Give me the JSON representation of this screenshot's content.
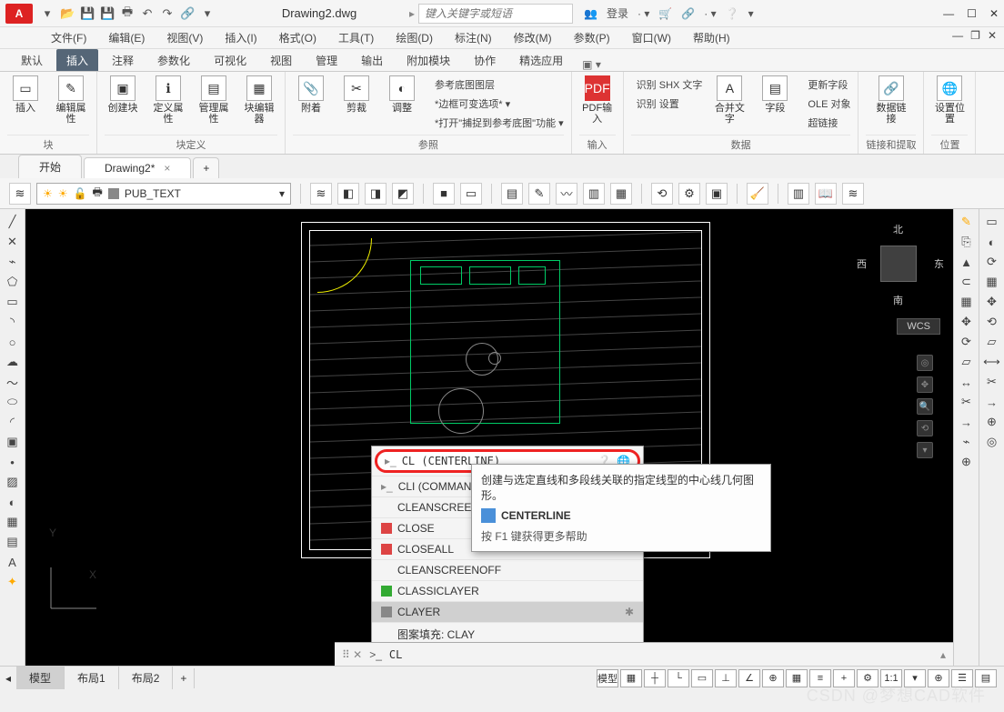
{
  "title": "Drawing2.dwg",
  "search_placeholder": "键入关键字或短语",
  "login": "登录",
  "menus": [
    "文件(F)",
    "编辑(E)",
    "视图(V)",
    "插入(I)",
    "格式(O)",
    "工具(T)",
    "绘图(D)",
    "标注(N)",
    "修改(M)",
    "参数(P)",
    "窗口(W)",
    "帮助(H)"
  ],
  "ribbon_tabs": [
    "默认",
    "插入",
    "注释",
    "参数化",
    "可视化",
    "视图",
    "管理",
    "输出",
    "附加模块",
    "协作",
    "精选应用"
  ],
  "active_ribbon_tab": "插入",
  "panels": {
    "block": {
      "title": "块",
      "items": [
        "插入",
        "编辑属性"
      ]
    },
    "blockdef": {
      "title": "块定义",
      "items": [
        "创建块",
        "定义属性",
        "管理属性",
        "块编辑器"
      ]
    },
    "ref": {
      "title": "参照",
      "items": [
        "附着",
        "剪裁",
        "调整"
      ],
      "lines": [
        "参考底图图层",
        "*边框可变选项* ▾",
        "*打开\"捕捉到参考底图\"功能 ▾"
      ]
    },
    "import": {
      "title": "输入",
      "items": [
        "PDF输入"
      ]
    },
    "merge": {
      "title": "",
      "items": [
        "合并文字",
        "字段"
      ],
      "lines": [
        "识别 SHX 文字",
        "识别 设置",
        "更新字段",
        "OLE 对象",
        "超链接"
      ]
    },
    "data": {
      "title": "数据"
    },
    "link": {
      "title": "链接和提取",
      "items": [
        "数据链接"
      ]
    },
    "loc": {
      "title": "位置",
      "items": [
        "设置位置"
      ]
    }
  },
  "doc_tabs": [
    "开始",
    "Drawing2*"
  ],
  "layer": "PUB_TEXT",
  "viewcube": {
    "n": "北",
    "s": "南",
    "e": "东",
    "w": "西"
  },
  "wcs": "WCS",
  "autocomplete": {
    "head": "CL (CENTERLINE)",
    "items": [
      "CLI (COMMANDLINE)",
      "CLEANSCREENON",
      "CLOSE",
      "CLOSEALL",
      "CLEANSCREENOFF",
      "CLASSICLAYER",
      "CLAYER",
      "图案填充: CLAY"
    ]
  },
  "tooltip": {
    "desc": "创建与选定直线和多段线关联的指定线型的中心线几何图形。",
    "cmd": "CENTERLINE",
    "help": "按 F1 键获得更多帮助"
  },
  "cmd_prompt": ">_",
  "cmd_value": "CL",
  "model_tabs": [
    "模型",
    "布局1",
    "布局2"
  ],
  "status_items": [
    "模型",
    "▦",
    "┼",
    "└",
    "▭",
    "⊥",
    "∠",
    "⊕",
    "▦",
    "≡",
    "+",
    "⚙",
    "1:1",
    "▾",
    "⊕",
    "☰",
    "▤"
  ],
  "watermark": "CSDN @梦想CAD软件"
}
